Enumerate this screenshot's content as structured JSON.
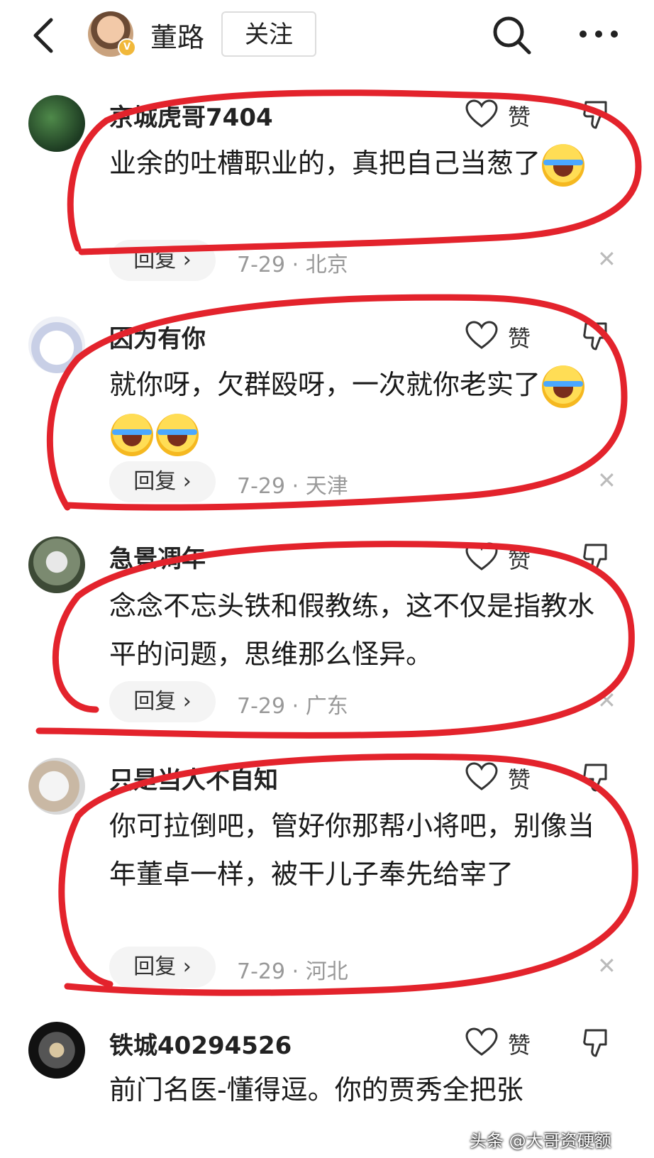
{
  "header": {
    "author_name": "董路",
    "follow_label": "关注",
    "verified_badge": "V"
  },
  "comments": [
    {
      "name": "京城虎哥7404",
      "text": "业余的吐槽职业的，真把自己当葱了",
      "emoji_count": 1,
      "like_label": "赞",
      "reply_label": "回复 ›",
      "date": "7-29",
      "location": "北京"
    },
    {
      "name": "因为有你",
      "text": "就你呀，欠群殴呀，一次就你老实了",
      "emoji_count": 3,
      "like_label": "赞",
      "reply_label": "回复 ›",
      "date": "7-29",
      "location": "天津"
    },
    {
      "name": "急景凋年",
      "text": "念念不忘头铁和假教练，这不仅是指教水平的问题，思维那么怪异。",
      "emoji_count": 0,
      "like_label": "赞",
      "reply_label": "回复 ›",
      "date": "7-29",
      "location": "广东"
    },
    {
      "name": "只是当人不自知",
      "text": "你可拉倒吧，管好你那帮小将吧，别像当年董卓一样，被干儿子奉先给宰了",
      "emoji_count": 0,
      "like_label": "赞",
      "reply_label": "回复 ›",
      "date": "7-29",
      "location": "河北"
    },
    {
      "name": "铁城40294526",
      "text": "前门名医-懂得逗。你的贾秀全把张",
      "emoji_count": 0,
      "like_label": "赞"
    }
  ],
  "separator": " · ",
  "close_glyph": "✕",
  "watermark": "头条 @大哥资硬额",
  "colors": {
    "annotation": "#e3232c"
  }
}
